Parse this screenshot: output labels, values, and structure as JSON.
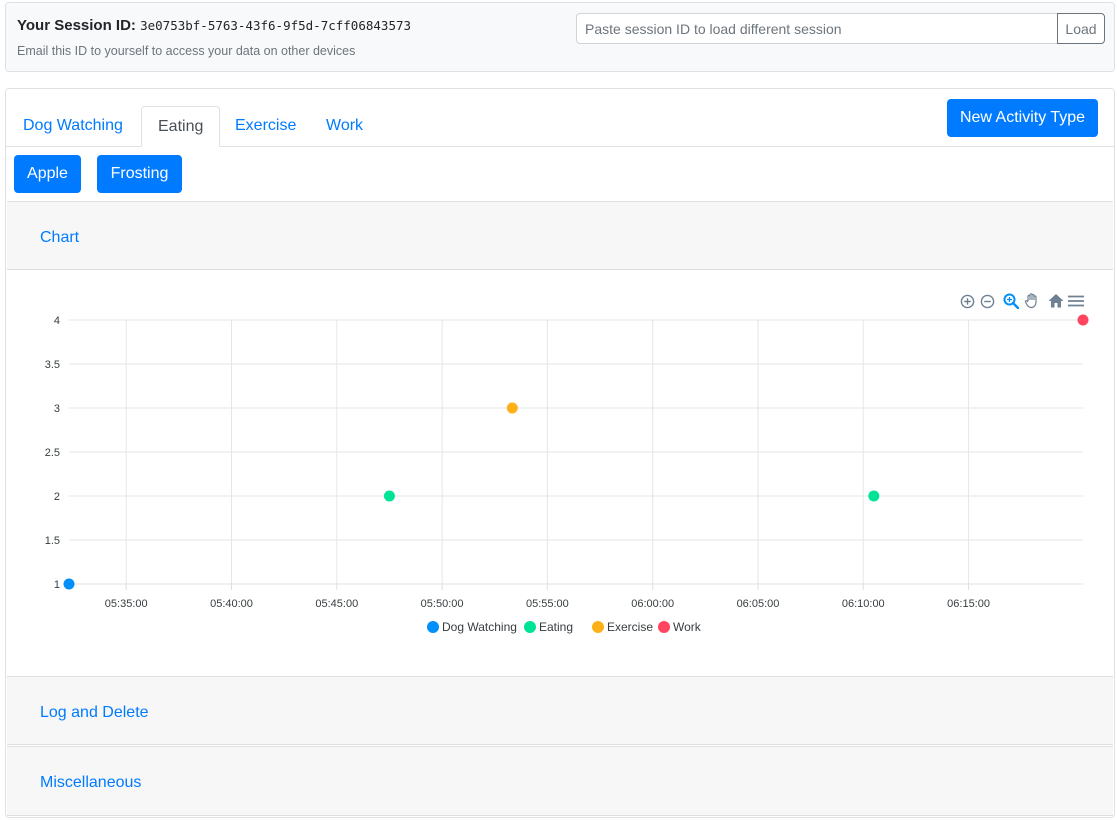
{
  "session": {
    "label": "Your Session ID:",
    "id": "3e0753bf-5763-43f6-9f5d-7cff06843573",
    "hint": "Email this ID to yourself to access your data on other devices",
    "input_placeholder": "Paste session ID to load different session",
    "input_value": "",
    "load_label": "Load"
  },
  "tabs": [
    {
      "label": "Dog Watching",
      "active": false
    },
    {
      "label": "Eating",
      "active": true
    },
    {
      "label": "Exercise",
      "active": false
    },
    {
      "label": "Work",
      "active": false
    }
  ],
  "new_activity_label": "New Activity Type",
  "sub_buttons": [
    "Apple",
    "Frosting"
  ],
  "sections": {
    "chart": "Chart",
    "log": "Log and Delete",
    "misc": "Miscellaneous"
  },
  "chart_toolbar": [
    "zoom-in-icon",
    "zoom-out-icon",
    "zoom-select-icon",
    "pan-icon",
    "reset-home-icon",
    "menu-icon"
  ],
  "chart_data": {
    "type": "scatter",
    "title": "",
    "xlabel": "",
    "ylabel": "",
    "ylim": [
      1,
      4
    ],
    "yticks": [
      "1",
      "1.5",
      "2",
      "2.5",
      "3",
      "3.5",
      "4"
    ],
    "xlim": [
      "05:32:17",
      "06:20:26"
    ],
    "xticks": [
      "05:35:00",
      "05:40:00",
      "05:45:00",
      "05:50:00",
      "05:55:00",
      "06:00:00",
      "06:05:00",
      "06:10:00",
      "06:15:00"
    ],
    "grid": true,
    "legend_position": "bottom",
    "series": [
      {
        "name": "Dog Watching",
        "color": "#008ffb",
        "points": [
          {
            "x": "05:32:17",
            "y": 1
          }
        ]
      },
      {
        "name": "Eating",
        "color": "#00e396",
        "points": [
          {
            "x": "05:47:30",
            "y": 2
          },
          {
            "x": "06:10:30",
            "y": 2
          }
        ]
      },
      {
        "name": "Exercise",
        "color": "#feb019",
        "points": [
          {
            "x": "05:53:20",
            "y": 3
          }
        ]
      },
      {
        "name": "Work",
        "color": "#ff4560",
        "points": [
          {
            "x": "06:20:26",
            "y": 4
          }
        ]
      }
    ]
  }
}
